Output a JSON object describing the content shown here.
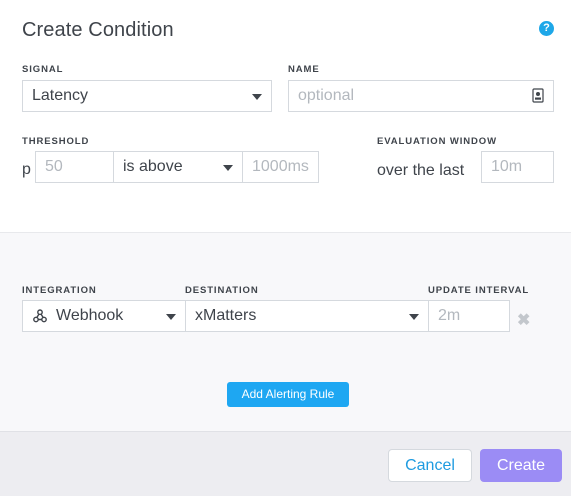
{
  "dialog": {
    "title": "Create Condition",
    "help_icon": "question-circle-icon"
  },
  "signal": {
    "label": "SIGNAL",
    "value": "Latency"
  },
  "name": {
    "label": "NAME",
    "placeholder": "optional"
  },
  "threshold": {
    "label": "THRESHOLD",
    "prefix": "p",
    "percentile_placeholder": "50",
    "operator": "is above",
    "value_placeholder": "1000ms"
  },
  "evaluation_window": {
    "label": "EVALUATION WINDOW",
    "text": "over the last",
    "placeholder": "10m"
  },
  "alerting_rule": {
    "integration_label": "INTEGRATION",
    "integration_value": "Webhook",
    "destination_label": "DESTINATION",
    "destination_value": "xMatters",
    "update_interval_label": "UPDATE INTERVAL",
    "update_interval_placeholder": "2m"
  },
  "buttons": {
    "add_alerting_rule": "Add Alerting Rule",
    "cancel": "Cancel",
    "create": "Create"
  },
  "colors": {
    "accent_blue": "#1ea7f2",
    "create_purple": "#9b8cf5"
  }
}
